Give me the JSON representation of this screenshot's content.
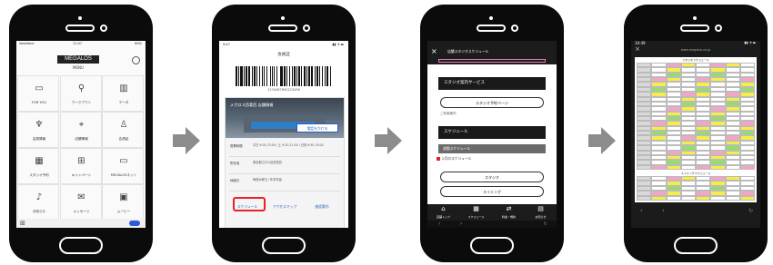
{
  "phone1": {
    "status_left": "Vodafone",
    "status_time": "11:07",
    "status_right": "80%",
    "logo": "MEGALOS",
    "menu_label": "MENU",
    "grid": [
      {
        "label": "FOR YOU",
        "icon": "card-icon"
      },
      {
        "label": "ワークアウト",
        "icon": "dumbbell-icon"
      },
      {
        "label": "データ",
        "icon": "chart-icon"
      },
      {
        "label": "会員情報",
        "icon": "food-icon"
      },
      {
        "label": "店舗情報",
        "icon": "location-icon"
      },
      {
        "label": "会員証",
        "icon": "person-icon"
      },
      {
        "label": "スタジオ予約",
        "icon": "calendar-icon"
      },
      {
        "label": "キャンペーン",
        "icon": "gift-icon"
      },
      {
        "label": "MEGALOSネット",
        "icon": "mega-icon"
      },
      {
        "label": "お知らせ",
        "icon": "bell-icon"
      },
      {
        "label": "メッセージ",
        "icon": "mail-icon"
      },
      {
        "label": "ムービー",
        "icon": "video-icon"
      }
    ]
  },
  "phone2": {
    "status_time": "9:47",
    "header": "会員証",
    "barcode_number": "1234567890123456",
    "banner_text": "メガロス西葛西 店舗情報",
    "call_button": "電話をかける",
    "rows": [
      {
        "label": "営業時間",
        "value": "平日 9:00-23:00 / 土 9:30-21:00 / 日祝 9:30-19:00"
      },
      {
        "label": "所在地",
        "value": "東京都江戸川区西葛西"
      },
      {
        "label": "休館日",
        "value": "毎週木曜日 / 年末年始"
      }
    ],
    "links": [
      "スケジュール",
      "アクセスマップ",
      "施設案内"
    ]
  },
  "phone3": {
    "header_title": "店舗スタジオスケジュール",
    "section1": "スタジオ案内サービス",
    "pill1": "スタジオ予約ページ",
    "note1": "ご利用案内",
    "section2": "スケジュール",
    "sub_section": "週間スケジュール",
    "note2": "2月のスケジュール",
    "pill2": "スタジオ",
    "pill3": "スイミング",
    "tabbar": [
      "店舗トップ",
      "スケジュール",
      "料金・規約",
      "お知らせ"
    ]
  },
  "phone4": {
    "status_time": "10:49",
    "url": "www.megalos.co.jp",
    "doc_title": "スタジオスケジュール",
    "doc_title2": "スイミングスケジュール"
  },
  "colors": {
    "highlight": "#e8202a",
    "timetable_yellow": "#f6ec4a",
    "timetable_green": "#8fdf6c",
    "timetable_pink": "#f7a3c8"
  }
}
